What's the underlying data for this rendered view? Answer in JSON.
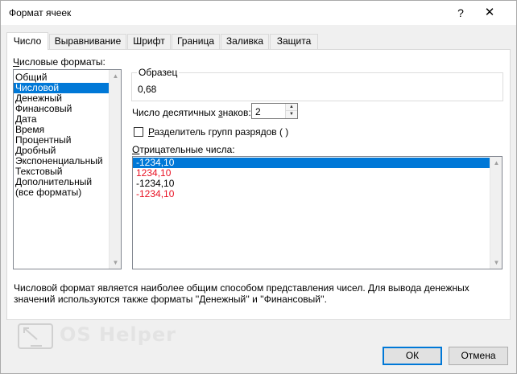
{
  "window": {
    "title": "Формат ячеек",
    "help_label": "?",
    "close_label": "✕"
  },
  "tabs": [
    {
      "label": "Число",
      "active": true
    },
    {
      "label": "Выравнивание"
    },
    {
      "label": "Шрифт"
    },
    {
      "label": "Граница"
    },
    {
      "label": "Заливка"
    },
    {
      "label": "Защита"
    }
  ],
  "formats": {
    "label_first": "Ч",
    "label_rest": "исловые форматы:",
    "items": [
      "Общий",
      "Числовой",
      "Денежный",
      "Финансовый",
      "Дата",
      "Время",
      "Процентный",
      "Дробный",
      "Экспоненциальный",
      "Текстовый",
      "Дополнительный",
      "(все форматы)"
    ],
    "selected_index": 1
  },
  "sample": {
    "title": "Образец",
    "value": "0,68"
  },
  "decimals": {
    "label_a": "Число десятичных ",
    "label_u": "з",
    "label_b": "наков:",
    "value": "2"
  },
  "separator": {
    "label_u": "Р",
    "label_rest": "азделитель групп разрядов ( )",
    "checked": false
  },
  "negatives": {
    "label_u": "О",
    "label_rest": "трицательные числа:",
    "items": [
      {
        "text": "-1234,10",
        "red": false
      },
      {
        "text": "1234,10",
        "red": true
      },
      {
        "text": "-1234,10",
        "red": false
      },
      {
        "text": "-1234,10",
        "red": true
      }
    ],
    "selected_index": 0
  },
  "description": "Числовой формат является наиболее общим способом представления чисел. Для вывода денежных значений используются также форматы ''Денежный'' и ''Финансовый''.",
  "watermark": "OS Helper",
  "buttons": {
    "ok": "ОК",
    "cancel": "Отмена"
  },
  "colors": {
    "selection": "#0078d7",
    "negative_red": "#e81123"
  }
}
